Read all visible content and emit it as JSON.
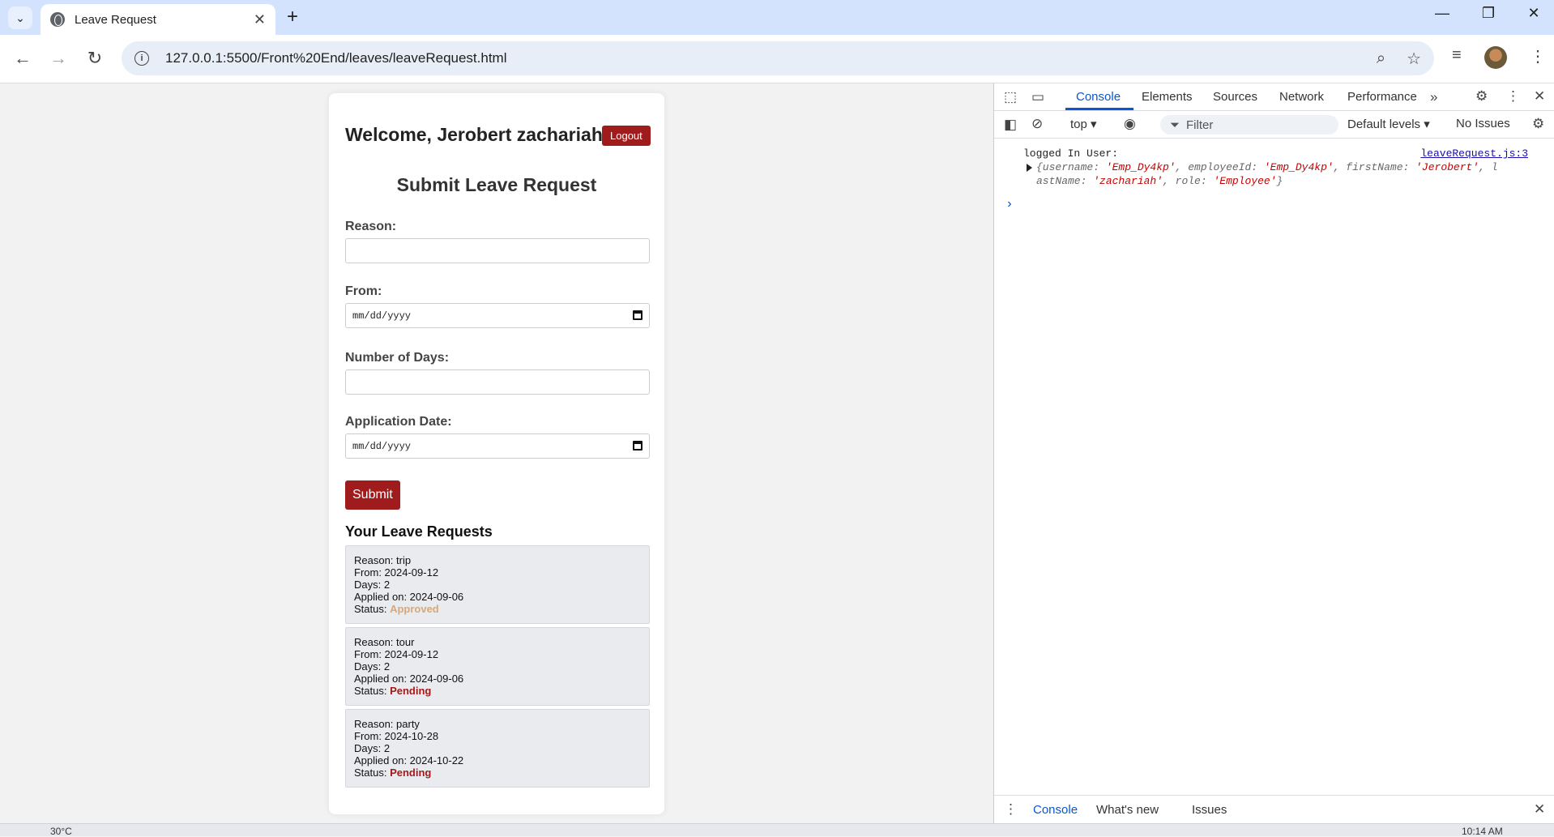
{
  "browser": {
    "tab_title": "Leave Request",
    "url": "127.0.0.1:5500/Front%20End/leaves/leaveRequest.html"
  },
  "page": {
    "welcome": "Welcome, Jerobert zachariah",
    "logout_label": "Logout",
    "form_title": "Submit Leave Request",
    "reason_label": "Reason:",
    "from_label": "From:",
    "from_value": "mm/dd/yyyy",
    "days_label": "Number of Days:",
    "app_date_label": "Application Date:",
    "app_date_value": "mm/dd/yyyy",
    "submit_label": "Submit",
    "requests_title": "Your Leave Requests",
    "requests": [
      {
        "reason": "Reason: trip",
        "from": "From: 2024-09-12",
        "days": "Days: 2",
        "applied": "Applied on: 2024-09-06",
        "status_label": "Status: ",
        "status": "Approved"
      },
      {
        "reason": "Reason: tour",
        "from": "From: 2024-09-12",
        "days": "Days: 2",
        "applied": "Applied on: 2024-09-06",
        "status_label": "Status: ",
        "status": "Pending"
      },
      {
        "reason": "Reason: party",
        "from": "From: 2024-10-28",
        "days": "Days: 2",
        "applied": "Applied on: 2024-10-22",
        "status_label": "Status: ",
        "status": "Pending"
      }
    ]
  },
  "devtools": {
    "tabs": [
      "Console",
      "Elements",
      "Sources",
      "Network",
      "Performance"
    ],
    "context": "top ▾",
    "filter_placeholder": "Filter",
    "levels": "Default levels ▾",
    "issues": "No Issues",
    "log_message": "logged In User:",
    "log_source": "leaveRequest.js:3",
    "obj_line1_k1": "{username: ",
    "obj_line1_v1": "'Emp_Dy4kp'",
    "obj_line1_k2": ", employeeId: ",
    "obj_line1_v2": "'Emp_Dy4kp'",
    "obj_line1_k3": ", firstName: ",
    "obj_line1_v3": "'Jerobert'",
    "obj_line1_k4": ", l",
    "obj_line2_k1": "astName: ",
    "obj_line2_v1": "'zachariah'",
    "obj_line2_k2": ", role: ",
    "obj_line2_v2": "'Employee'",
    "obj_line2_end": "}",
    "drawer_tabs": [
      "Console",
      "What's new",
      "Issues"
    ]
  },
  "taskbar": {
    "temp": "30°C",
    "time": "10:14 AM"
  },
  "colors": {
    "accent": "#a01c1c",
    "approved": "#d8a878",
    "devtools_active": "#0b57d0"
  }
}
